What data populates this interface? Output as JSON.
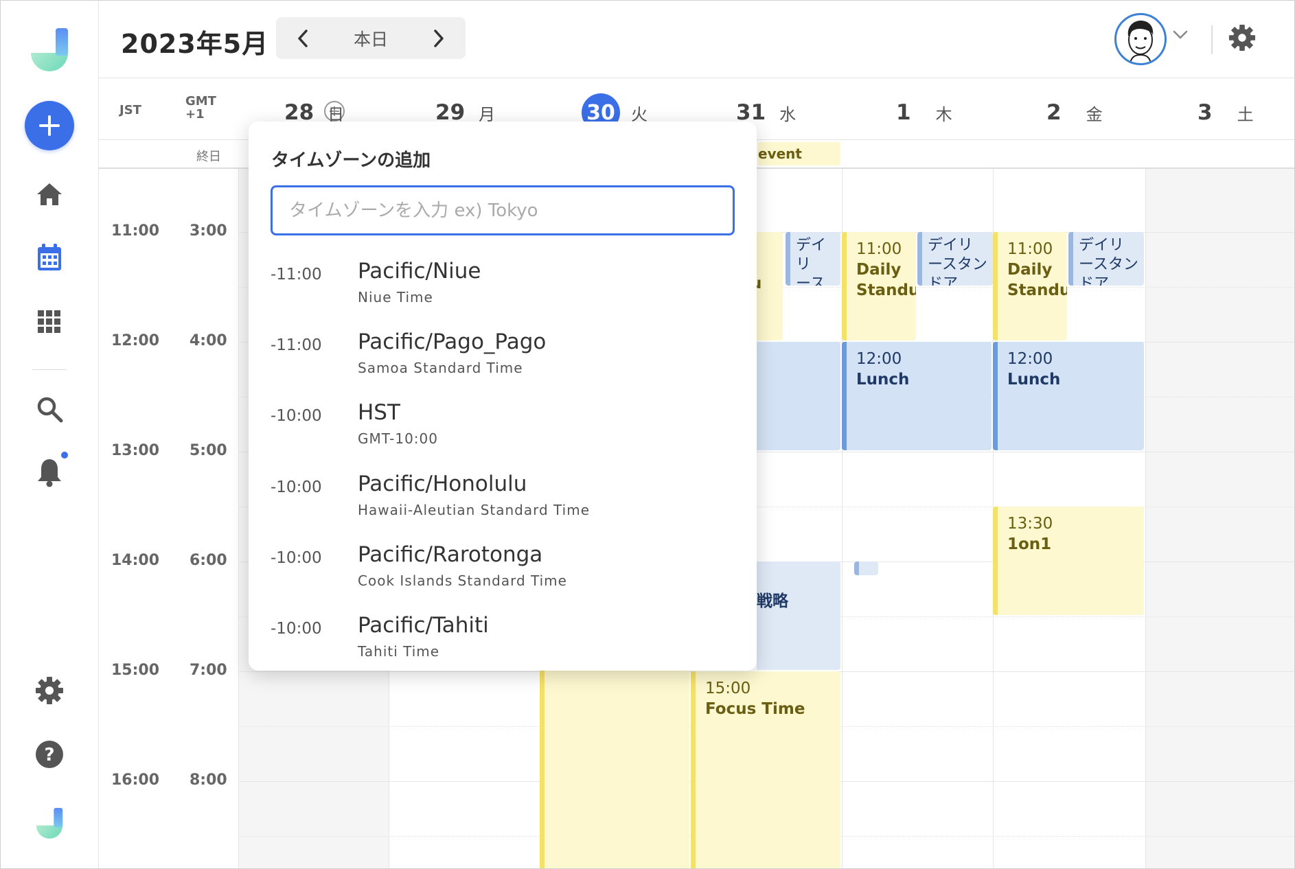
{
  "header": {
    "month_title": "2023年5月",
    "today_label": "本日"
  },
  "timezones": {
    "primary": "JST",
    "secondary": "GMT\n+1",
    "allday_label": "終日"
  },
  "days": [
    {
      "num": "28",
      "name": "日"
    },
    {
      "num": "29",
      "name": "月"
    },
    {
      "num": "30",
      "name": "火",
      "today": true
    },
    {
      "num": "31",
      "name": "水"
    },
    {
      "num": "1",
      "name": "木"
    },
    {
      "num": "2",
      "name": "金"
    },
    {
      "num": "3",
      "name": "土"
    }
  ],
  "hours": [
    {
      "primary": "11:00",
      "secondary": "3:00"
    },
    {
      "primary": "12:00",
      "secondary": "4:00"
    },
    {
      "primary": "13:00",
      "secondary": "5:00"
    },
    {
      "primary": "14:00",
      "secondary": "6:00"
    },
    {
      "primary": "15:00",
      "secondary": "7:00"
    },
    {
      "primary": "16:00",
      "secondary": "8:00"
    }
  ],
  "events": {
    "allday_partial": "event",
    "daily_label": "デイリ\nースタン\nドア",
    "thu_standup": {
      "time": "11:00",
      "title": "Daily\nStandup"
    },
    "fri_standup": {
      "time": "11:00",
      "title": "Daily\nStandup"
    },
    "wed_standup_partial": "u",
    "thu_lunch": {
      "time": "12:00",
      "title": "Lunch"
    },
    "fri_lunch": {
      "time": "12:00",
      "title": "Lunch"
    },
    "fri_1on1": {
      "time": "13:30",
      "title": "1on1"
    },
    "wed_strategy_partial": "戦略",
    "wed_focus": {
      "time": "15:00",
      "title": "Focus Time"
    }
  },
  "popover": {
    "title": "タイムゾーンの追加",
    "input_placeholder": "タイムゾーンを入力 ex) Tokyo",
    "items": [
      {
        "offset": "-11:00",
        "name": "Pacific/Niue",
        "desc": "Niue Time"
      },
      {
        "offset": "-11:00",
        "name": "Pacific/Pago_Pago",
        "desc": "Samoa Standard Time"
      },
      {
        "offset": "-10:00",
        "name": "HST",
        "desc": "GMT-10:00"
      },
      {
        "offset": "-10:00",
        "name": "Pacific/Honolulu",
        "desc": "Hawaii-Aleutian Standard Time"
      },
      {
        "offset": "-10:00",
        "name": "Pacific/Rarotonga",
        "desc": "Cook Islands Standard Time"
      },
      {
        "offset": "-10:00",
        "name": "Pacific/Tahiti",
        "desc": "Tahiti Time"
      }
    ]
  },
  "icons": {
    "logo": "app-logo",
    "add": "plus-icon",
    "home": "home-icon",
    "calendar": "calendar-icon",
    "apps": "grid-icon",
    "search": "search-icon",
    "notifications": "bell-icon",
    "settings": "gear-icon",
    "help": "help-icon"
  },
  "colors": {
    "accent": "#3b6fe8",
    "event_yellow": "#fdf8cf",
    "event_blue": "#d3e2f4"
  }
}
